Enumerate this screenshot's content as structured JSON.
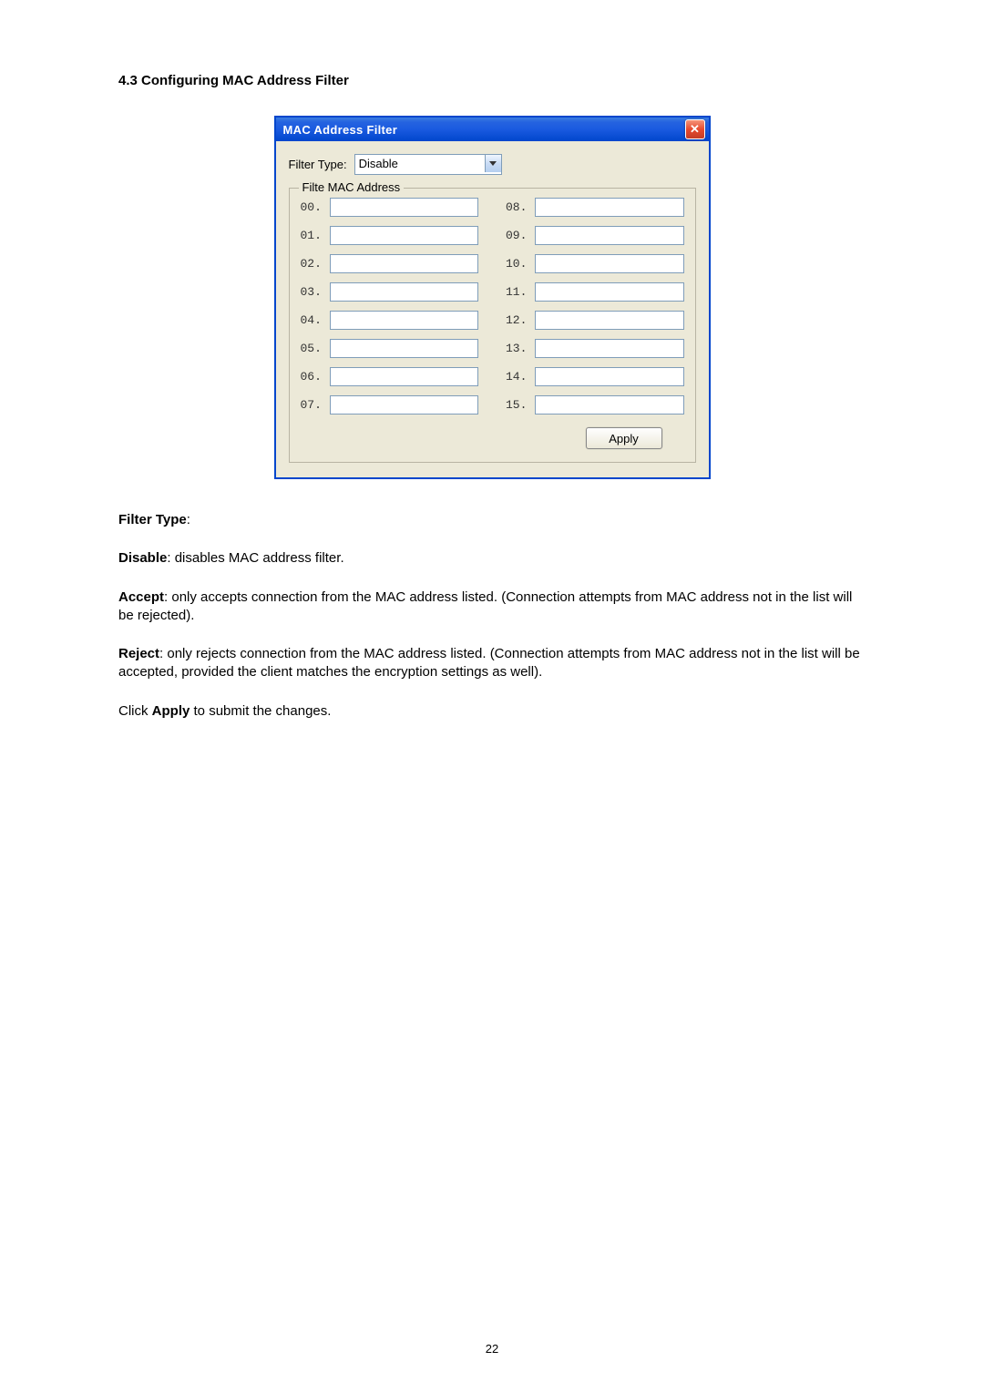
{
  "heading": "4.3 Configuring MAC Address Filter",
  "dialog": {
    "title": "MAC Address Filter",
    "close_glyph": "✕",
    "filter_type_label": "Filter Type:",
    "filter_type_value": "Disable",
    "fieldset_legend": "Filte MAC Address",
    "left_labels": [
      "00.",
      "01.",
      "02.",
      "03.",
      "04.",
      "05.",
      "06.",
      "07."
    ],
    "right_labels": [
      "08.",
      "09.",
      "10.",
      "11.",
      "12.",
      "13.",
      "14.",
      "15."
    ],
    "apply_label": "Apply"
  },
  "text": {
    "filter_type_heading": "Filter Type",
    "disable_label": "Disable",
    "disable_text": ": disables MAC address filter.",
    "accept_label": "Accept",
    "accept_text": ": only accepts connection from the MAC address listed. (Connection attempts from MAC address not in the list will be rejected).",
    "reject_label": "Reject",
    "reject_text": ": only rejects connection from the MAC address listed. (Connection attempts from MAC address not in the list will be accepted, provided the client matches the encryption settings as well).",
    "click_label": "Click ",
    "apply_label": "Apply",
    "click_text": " to submit the changes."
  },
  "page_number": "22"
}
